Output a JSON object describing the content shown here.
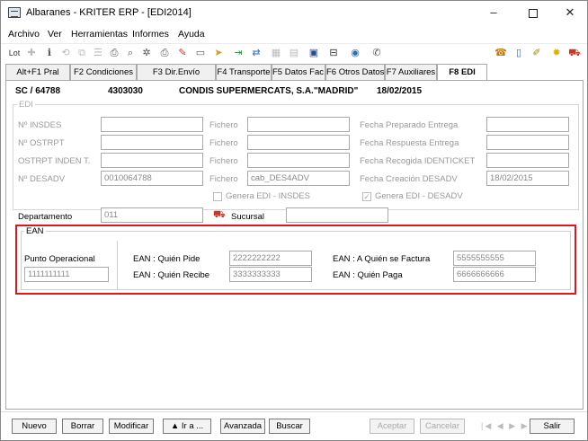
{
  "window": {
    "title": "Albaranes - KRITER ERP - [EDI2014]",
    "minimize": "–",
    "close": "✕"
  },
  "menu": [
    "Archivo",
    "Ver",
    "Herramientas",
    "Informes",
    "Ayuda"
  ],
  "toolbar": {
    "icons": [
      "lot-icon",
      "add-icon",
      "info-icon",
      "history-icon",
      "copy-icon",
      "list-icon",
      "print-icon",
      "preview-icon",
      "settings-icon",
      "print-alt-icon",
      "edit-icon",
      "rectangle-icon",
      "pointer-icon",
      "export-icon",
      "transfer-icon",
      "calculator-icon",
      "grid-icon",
      "tree-icon",
      "document-icon",
      "eye-icon",
      "phone-icon",
      "battery-icon",
      "attach-icon",
      "bulb-icon",
      "car-icon"
    ],
    "lot_label": "Lot"
  },
  "tabs": [
    {
      "label": "Alt+F1 Pral"
    },
    {
      "label": "F2 Condiciones"
    },
    {
      "label": "F3 Dir.Envío"
    },
    {
      "label": "F4 Transporte"
    },
    {
      "label": "F5 Datos Fac."
    },
    {
      "label": "F6 Otros Datos"
    },
    {
      "label": "F7 Auxiliares"
    },
    {
      "label": "F8 EDI",
      "active": true
    }
  ],
  "header": {
    "doc": "SC / 64788",
    "code": "4303030",
    "client": "CONDIS SUPERMERCATS, S.A.\"MADRID\"",
    "date": "18/02/2015"
  },
  "edi": {
    "legend": "EDI",
    "rows": [
      {
        "label": "Nº INSDES",
        "value": "",
        "fichero_label": "Fichero",
        "fichero": "",
        "right_label": "Fecha Preparado Entrega",
        "right_value": ""
      },
      {
        "label": "Nº OSTRPT",
        "value": "",
        "fichero_label": "Fichero",
        "fichero": "",
        "right_label": "Fecha Respuesta Entrega",
        "right_value": ""
      },
      {
        "label": "OSTRPT INDEN T.",
        "value": "",
        "fichero_label": "Fichero",
        "fichero": "",
        "right_label": "Fecha Recogida IDENTICKET",
        "right_value": ""
      },
      {
        "label": "Nº DESADV",
        "value": "0010064788",
        "fichero_label": "Fichero",
        "fichero": "cab_DES4ADV",
        "right_label": "Fecha Creación DESADV",
        "right_value": "18/02/2015"
      }
    ],
    "genera_insdes": "Genera EDI - INSDES",
    "genera_desadv": "Genera EDI - DESADV",
    "genera_desadv_checked": "✓"
  },
  "departamento": {
    "label": "Departamento",
    "value": "011",
    "sucursal_label": "Sucursal",
    "sucursal_value": ""
  },
  "ean": {
    "legend": "EAN",
    "punto_label": "Punto Operacional",
    "punto_value": "1111111111",
    "pide_label": "EAN : Quién Pide",
    "pide_value": "2222222222",
    "recibe_label": "EAN : Quién Recibe",
    "recibe_value": "3333333333",
    "factura_label": "EAN : A Quién se Factura",
    "factura_value": "5555555555",
    "paga_label": "EAN : Quién Paga",
    "paga_value": "6666666666"
  },
  "buttons": {
    "nuevo": "Nuevo",
    "borrar": "Borrar",
    "modificar": "Modificar",
    "ira": "▲ Ir a ...",
    "avanzada": "Avanzada",
    "buscar": "Buscar",
    "aceptar": "Aceptar",
    "cancelar": "Cancelar",
    "salir": "Salir",
    "nav": "|◀ ◀ ▶ ▶|"
  },
  "colors": {
    "highlight": "#e0161c",
    "sucursal_icon": "#c0392b"
  }
}
